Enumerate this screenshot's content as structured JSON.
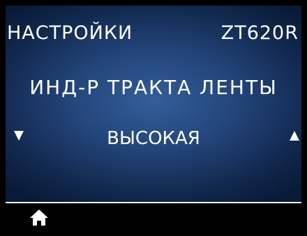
{
  "header": {
    "title": "НАСТРОЙКИ",
    "model": "ZT620R"
  },
  "menu": {
    "item_label": "ИНД-Р ТРАКТА ЛЕНТЫ",
    "value": "ВЫСОКАЯ"
  },
  "icons": {
    "prev": "triangle-down-icon",
    "next": "triangle-up-icon",
    "home": "home-icon"
  },
  "colors": {
    "background_center": "#345e9a",
    "background_edge": "#081a36",
    "text": "#ffffff",
    "bar": "#000000"
  }
}
